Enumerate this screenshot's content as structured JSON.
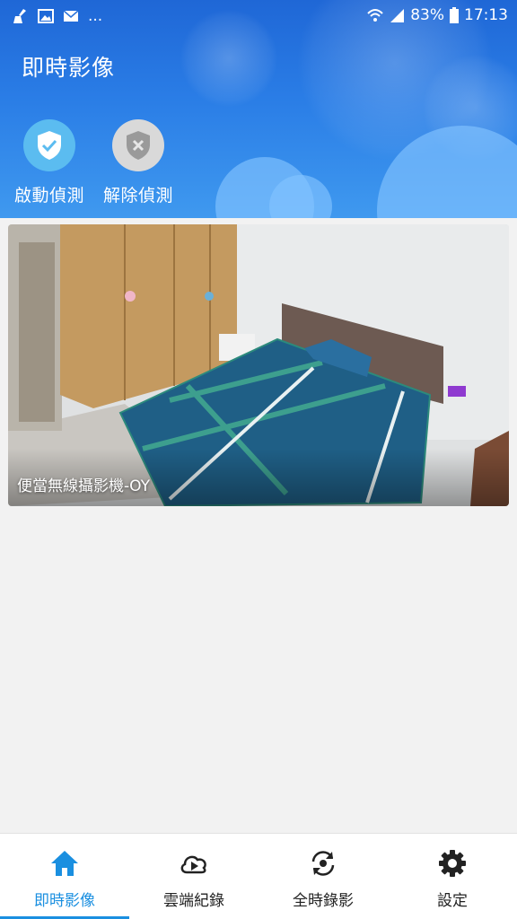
{
  "status_bar": {
    "more": "...",
    "battery": "83%",
    "time": "17:13"
  },
  "header": {
    "title": "即時影像",
    "actions": [
      {
        "label": "啟動偵測",
        "icon": "shield-check-icon",
        "color": "#5bbcf0"
      },
      {
        "label": "解除偵測",
        "icon": "shield-x-icon",
        "color": "#d9d9d9"
      }
    ]
  },
  "camera": {
    "name": "便當無線攝影機-OY"
  },
  "bottom_nav": {
    "items": [
      {
        "label": "即時影像",
        "icon": "home-icon",
        "active": true
      },
      {
        "label": "雲端紀錄",
        "icon": "cloud-play-icon",
        "active": false
      },
      {
        "label": "全時錄影",
        "icon": "sync-record-icon",
        "active": false
      },
      {
        "label": "設定",
        "icon": "gear-icon",
        "active": false
      }
    ]
  },
  "colors": {
    "accent": "#1a8fe0",
    "header_top": "#1f67d6",
    "header_bottom": "#3f99ef"
  }
}
